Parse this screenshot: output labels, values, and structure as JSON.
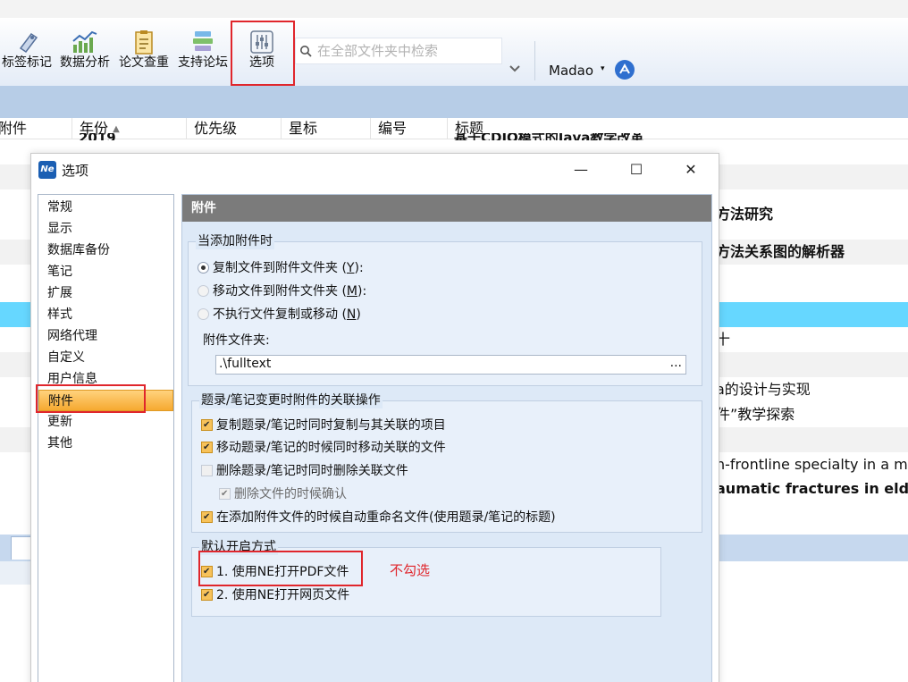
{
  "toolbar": {
    "buttons": [
      {
        "label": "标签标记",
        "icon": "tag-icon"
      },
      {
        "label": "数据分析",
        "icon": "chart-icon"
      },
      {
        "label": "论文查重",
        "icon": "clipboard-icon"
      },
      {
        "label": "支持论坛",
        "icon": "forum-icon"
      },
      {
        "label": "选项",
        "icon": "sliders-icon"
      }
    ],
    "search_placeholder": "在全部文件夹中检索",
    "user": "Madao",
    "user_caret": "▾"
  },
  "columns": [
    "附件",
    "年份",
    "优先级",
    "星标",
    "编号",
    "标题"
  ],
  "sort_indicator": "▲",
  "partial_row_year": "2019",
  "partial_row_title": "基于CDIO模式的Java教学改革",
  "rows": [
    {
      "title": "",
      "style": "plain"
    },
    {
      "title": "",
      "style": "plain"
    },
    {
      "title": "方法研究",
      "style": "bold"
    },
    {
      "title": "",
      "style": "plain"
    },
    {
      "title": "方法关系图的解析器",
      "style": "bold"
    },
    {
      "title": "",
      "style": "plain"
    },
    {
      "title": "",
      "style": "sel"
    },
    {
      "title": "十",
      "style": "plain"
    },
    {
      "title": "",
      "style": "plain"
    },
    {
      "title": "a的设计与实现",
      "style": "plain"
    },
    {
      "title": "件”教学探索",
      "style": "plain"
    },
    {
      "title": "",
      "style": "plain"
    },
    {
      "title": "n-frontline specialty in a m",
      "style": "plain"
    },
    {
      "title": "aumatic fractures in elder",
      "style": "bold"
    }
  ],
  "dialog": {
    "title": "选项",
    "app_icon_text": "Ne",
    "controls": {
      "minimize": "—",
      "maximize": "☐",
      "close": "✕"
    },
    "nav": [
      "常规",
      "显示",
      "数据库备份",
      "笔记",
      "扩展",
      "样式",
      "网络代理",
      "自定义",
      "用户信息",
      "附件",
      "更新",
      "其他"
    ],
    "selected_nav": "附件",
    "pane_title": "附件",
    "group1": {
      "title": "当添加附件时",
      "radio1": {
        "label": "复制文件到附件文件夹 (",
        "key": "Y",
        "tail": "):"
      },
      "radio2": {
        "label": "移动文件到附件文件夹 (",
        "key": "M",
        "tail": "):"
      },
      "radio3": {
        "label": "不执行文件复制或移动 (",
        "key": "N",
        "tail": ")"
      },
      "folder_label": "附件文件夹:",
      "folder_value": ".\\fulltext",
      "browse_label": "..."
    },
    "group2": {
      "title": "题录/笔记变更时附件的关联操作",
      "opt1": "复制题录/笔记时同时复制与其关联的项目",
      "opt2": "移动题录/笔记的时候同时移动关联的文件",
      "opt3": "删除题录/笔记时同时删除关联文件",
      "opt4": "删除文件的时候确认",
      "opt5": "在添加附件文件的时候自动重命名文件(使用题录/笔记的标题)"
    },
    "group3": {
      "title": "默认开启方式",
      "opt1": "1. 使用NE打开PDF文件",
      "opt2": "2. 使用NE打开网页文件"
    }
  },
  "annotation": "不勾选",
  "colors": {
    "accent": "#e0262c",
    "selection": "#66d7ff",
    "nav_selected": "#f6a930"
  }
}
